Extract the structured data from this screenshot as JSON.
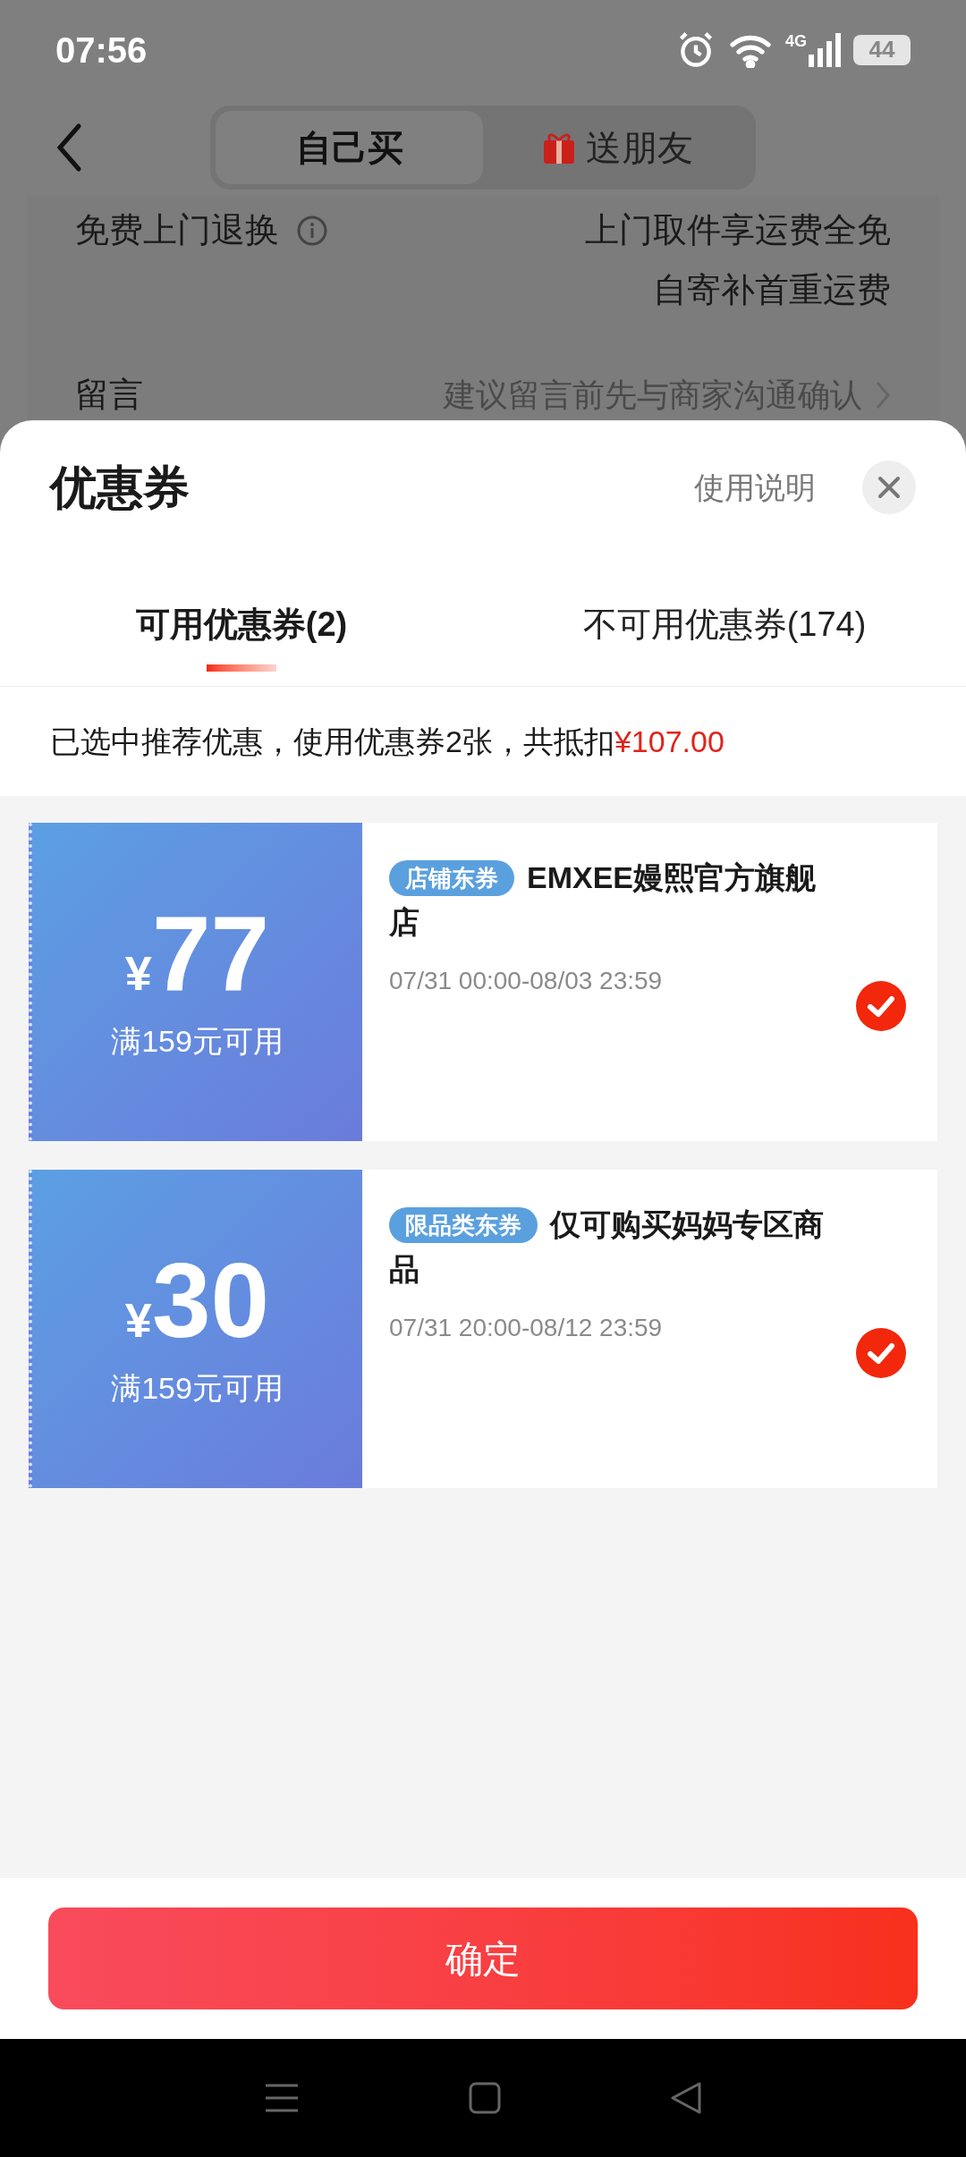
{
  "status_bar": {
    "time": "07:56",
    "network": "4G",
    "battery": "44"
  },
  "header": {
    "tabs": [
      {
        "label": "自己买",
        "selected": true,
        "kind": "plain"
      },
      {
        "label": "送朋友",
        "selected": false,
        "kind": "gift"
      }
    ]
  },
  "page_rows": [
    {
      "kind": "info",
      "label": "免费上门退换",
      "values": [
        "上门取件享运费全免",
        "自寄补首重运费"
      ]
    },
    {
      "kind": "link",
      "label": "留言",
      "placeholder": "建议留言前先与商家沟通确认"
    }
  ],
  "sheet": {
    "title": "优惠券",
    "help_link": "使用说明",
    "tabs": [
      {
        "label": "可用优惠券(2)",
        "selected": true
      },
      {
        "label": "不可用优惠券(174)",
        "selected": false
      }
    ],
    "summary": {
      "text": "已选中推荐优惠，使用优惠券2张，共抵扣",
      "amount": "¥107.00"
    },
    "coupons": [
      {
        "currency": "¥",
        "amount": "77",
        "condition": "满159元可用",
        "tag": "店铺东券",
        "title": "EMXEE嫚熙官方旗舰店",
        "validity": "07/31 00:00-08/03 23:59",
        "selected": true
      },
      {
        "currency": "¥",
        "amount": "30",
        "condition": "满159元可用",
        "tag": "限品类东券",
        "title": "仅可购买妈妈专区商品",
        "validity": "07/31 20:00-08/12 23:59",
        "selected": true
      }
    ],
    "confirm_button": "确定"
  }
}
